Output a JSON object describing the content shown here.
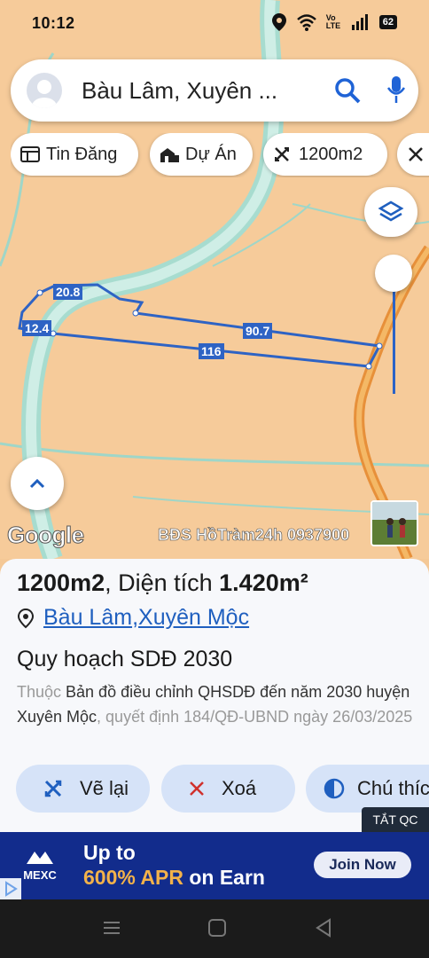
{
  "status_bar": {
    "time": "10:12",
    "volte": "Vo LTE",
    "battery": "62"
  },
  "search": {
    "text": "Bàu Lâm, Xuyên ..."
  },
  "chips": [
    {
      "label": "Tin Đăng",
      "icon": "listing-icon"
    },
    {
      "label": "Dự Án",
      "icon": "project-icon"
    },
    {
      "label": "1200m2",
      "icon": "area-icon"
    }
  ],
  "map": {
    "dimensions": [
      "20.8",
      "12.4",
      "90.7",
      "116"
    ],
    "google": "Google",
    "watermark": "BĐS HồTràm24h 0937900",
    "parcel_color": "#2e63c4",
    "road_color": "#f0a43a",
    "zone_color": "#9fd6c8"
  },
  "sheet": {
    "title_name": "1200m2",
    "title_sep": ", Diện tích ",
    "title_area": "1.420m²",
    "location_1": "Bàu Lâm",
    "location_sep": ", ",
    "location_2": "Xuyên Mộc",
    "plan_title": "Quy hoạch SDĐ 2030",
    "desc_prefix": "Thuộc ",
    "desc_map": "Bản đồ điều chỉnh QHSDĐ đến năm 2030 huyện Xuyên Mộc",
    "desc_suffix": ", quyết định 184/QĐ-UBND ngày 26/03/2025"
  },
  "actions": {
    "redraw": "Vẽ lại",
    "delete": "Xoá",
    "legend": "Chú thích"
  },
  "ad": {
    "close_label": "TẮT QC",
    "logo": "MEXC",
    "headline_line1": "Up to",
    "headline_accent": "600% APR",
    "headline_rest": " on Earn",
    "cta": "Join Now",
    "bg_color": "#122c8c",
    "accent_color": "#f3b24a"
  }
}
